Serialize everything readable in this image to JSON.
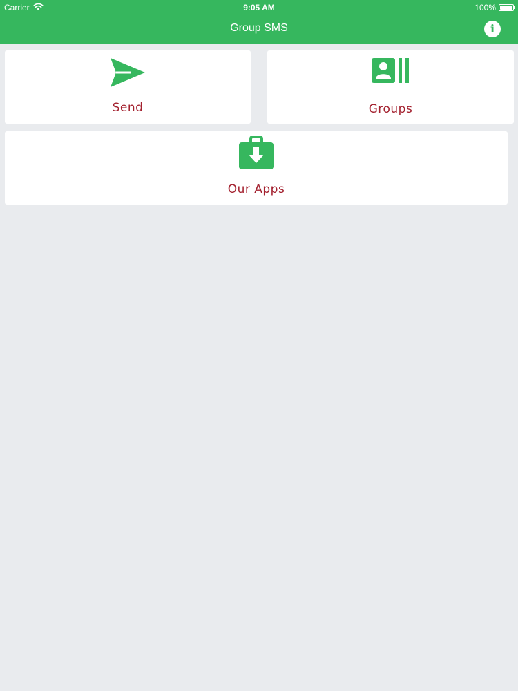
{
  "status_bar": {
    "carrier": "Carrier",
    "time": "9:05 AM",
    "battery": "100%"
  },
  "nav": {
    "title": "Group SMS",
    "info_label": "i"
  },
  "tiles": {
    "send": {
      "label": "Send",
      "icon": "send-icon"
    },
    "groups": {
      "label": "Groups",
      "icon": "contacts-icon"
    },
    "apps": {
      "label": "Our Apps",
      "icon": "download-briefcase-icon"
    }
  },
  "colors": {
    "accent": "#36b75e",
    "label": "#a3202e",
    "background": "#e9ebee"
  }
}
